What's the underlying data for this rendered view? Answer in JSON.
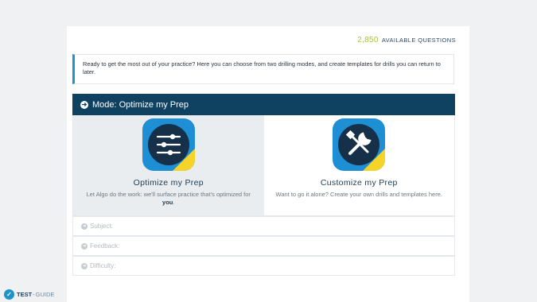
{
  "header": {
    "question_count": "2,850",
    "question_label": "AVAILABLE QUESTIONS"
  },
  "intro": {
    "text": "Ready to get the most out of your practice? Here you can choose from two drilling modes, and create templates for drills you can return to later."
  },
  "mode": {
    "label": "Mode: Optimize my Prep"
  },
  "options": [
    {
      "title": "Optimize my Prep",
      "desc_prefix": "Let Algo do the work: we'll surface practice that's optimized for ",
      "desc_bold": "you",
      "desc_suffix": ".",
      "icon": "sliders-icon",
      "selected": true
    },
    {
      "title": "Customize my Prep",
      "desc": "Want to go it alone? Create your own drills and templates here.",
      "icon": "tools-icon",
      "selected": false
    }
  ],
  "filters": [
    {
      "label": "Subject:"
    },
    {
      "label": "Feedback:"
    },
    {
      "label": "Difficulty:"
    }
  ],
  "branding": {
    "name_a": "TEST",
    "separator": "-",
    "name_b": "GUIDE"
  },
  "colors": {
    "header_bg": "#0f4160",
    "accent_blue": "#1c93c9",
    "count_green": "#a8c23a",
    "icon_yellow": "#f6d329"
  }
}
